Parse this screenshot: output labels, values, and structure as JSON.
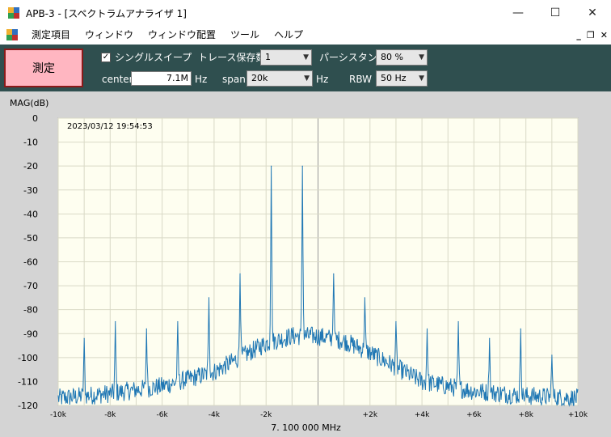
{
  "window": {
    "title": "APB-3 - [スペクトラムアナライザ 1]",
    "minimize_icon": "—",
    "maximize_icon": "☐",
    "close_icon": "✕"
  },
  "menu": {
    "items": [
      "測定項目",
      "ウィンドウ",
      "ウィンドウ配置",
      "ツール",
      "ヘルプ"
    ],
    "mdi_minimize": "_",
    "mdi_restore": "❐",
    "mdi_close": "✕"
  },
  "toolbar": {
    "measure_label": "測定",
    "single_sweep_label": "シングルスイープ",
    "single_sweep_checked": "✓",
    "trace_label": "トレース保存数",
    "trace_value": "1",
    "persistence_label": "パーシスタンス",
    "persistence_value": "80 %",
    "center_label": "center",
    "center_value": "7.1M",
    "center_unit": "Hz",
    "span_label": "span",
    "span_value": "20k",
    "span_unit": "Hz",
    "rbw_label": "RBW",
    "rbw_value": "50 Hz"
  },
  "plot": {
    "timestamp": "2023/03/12 19:54:53",
    "center_freq_label": "7. 100 000 MHz",
    "background_color": "#fefef0",
    "trace_color": "#1f77b4"
  },
  "chart_data": {
    "type": "line",
    "ylabel": "MAG(dB)",
    "xlabel": "7. 100 000 MHz",
    "xlim": [
      -10,
      10
    ],
    "ylim": [
      -120,
      0
    ],
    "xticks": [
      -10,
      -8,
      -6,
      -4,
      -2,
      0,
      2,
      4,
      6,
      8,
      10
    ],
    "xtick_labels": [
      "-10k",
      "-8k",
      "-6k",
      "-4k",
      "-2k",
      "",
      "+2k",
      "+4k",
      "+6k",
      "+8k",
      "+10k"
    ],
    "yticks": [
      0,
      -10,
      -20,
      -30,
      -40,
      -50,
      -60,
      -70,
      -80,
      -90,
      -100,
      -110,
      -120
    ],
    "ytick_labels": [
      "0",
      "-10",
      "-20",
      "-30",
      "-40",
      "-50",
      "-60",
      "-70",
      "-80",
      "-90",
      "-100",
      "-110",
      "-120"
    ],
    "grid": true,
    "noise_floor": {
      "x": [
        -10,
        -8,
        -6,
        -4,
        -3,
        -2,
        -1,
        0,
        1,
        2,
        3,
        4,
        6,
        8,
        10
      ],
      "y": [
        -117,
        -115,
        -112,
        -106,
        -100,
        -94,
        -91,
        -91,
        -93,
        -98,
        -104,
        -110,
        -114,
        -116,
        -117
      ]
    },
    "peaks": {
      "x": [
        -9.0,
        -7.8,
        -6.6,
        -5.4,
        -4.2,
        -3.0,
        -1.8,
        -0.6,
        0.6,
        1.8,
        3.0,
        4.2,
        5.4,
        6.6,
        7.8,
        9.0
      ],
      "y": [
        -92,
        -85,
        -88,
        -85,
        -75,
        -65,
        -20,
        -20,
        -65,
        -75,
        -85,
        -88,
        -85,
        -92,
        -88,
        -99
      ]
    }
  }
}
